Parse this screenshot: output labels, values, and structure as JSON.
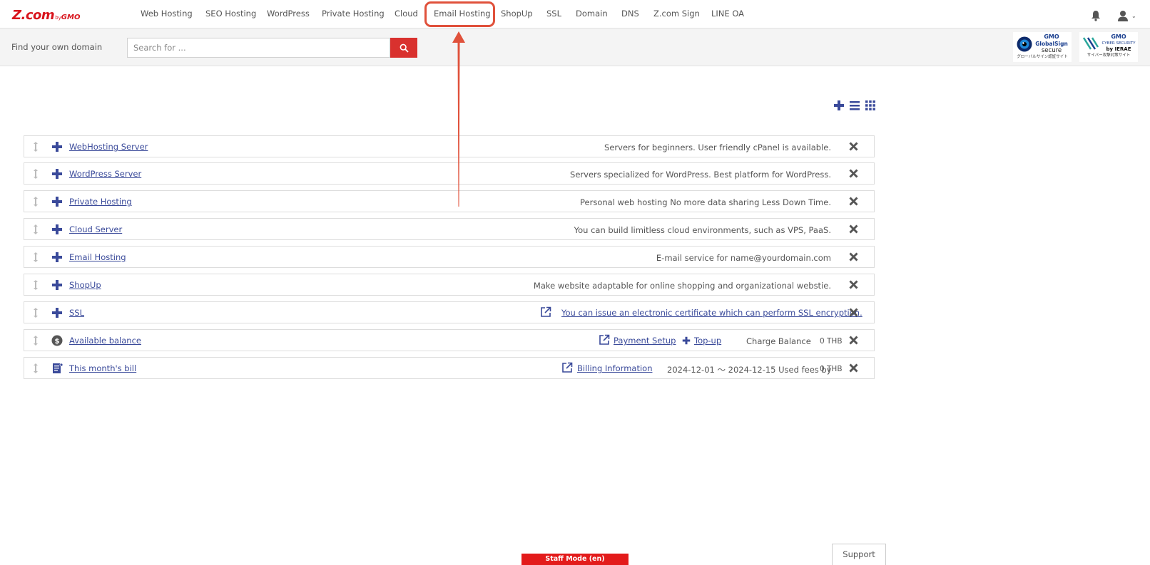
{
  "brand": {
    "logo_main": "Z.com",
    "logo_by": "by",
    "logo_gmo": "GMO"
  },
  "nav": {
    "items": [
      {
        "label": "Web Hosting"
      },
      {
        "label": "SEO Hosting"
      },
      {
        "label": "WordPress"
      },
      {
        "label": "Private Hosting"
      },
      {
        "label": "Cloud"
      },
      {
        "label": "Email Hosting"
      },
      {
        "label": "ShopUp"
      },
      {
        "label": "SSL"
      },
      {
        "label": "Domain"
      },
      {
        "label": "DNS"
      },
      {
        "label": "Z.com Sign"
      },
      {
        "label": "LINE OA"
      }
    ],
    "highlighted": "Email Hosting",
    "icons": [
      "bell-icon",
      "user-icon"
    ]
  },
  "search": {
    "label": "Find your own domain",
    "placeholder": "Search for ...",
    "value": ""
  },
  "badges": {
    "globalsign": {
      "gmo": "GMO",
      "name": "GlobalSign",
      "secure": "secure",
      "jp": "グローバルサイン認証サイト"
    },
    "ierae": {
      "gmo": "GMO",
      "name": "CYBER SECURITY",
      "by": "by IERAE",
      "jp": "サイバー攻撃対策サイト"
    }
  },
  "view_tools": [
    "plus-icon",
    "list-view-icon",
    "grid-view-icon"
  ],
  "widgets": [
    {
      "title": "WebHosting Server",
      "description": "Servers for beginners. User friendly cPanel is available.",
      "icon": "plus-icon"
    },
    {
      "title": "WordPress Server",
      "description": "Servers specialized for WordPress. Best platform for WordPress.",
      "icon": "plus-icon"
    },
    {
      "title": "Private Hosting",
      "description": "Personal web hosting No more data sharing Less Down Time.",
      "icon": "plus-icon"
    },
    {
      "title": "Cloud Server",
      "description": "You can build limitless cloud environments, such as VPS, PaaS.",
      "icon": "plus-icon"
    },
    {
      "title": "Email Hosting",
      "description": "E-mail service for name@yourdomain.com",
      "icon": "plus-icon"
    },
    {
      "title": "ShopUp",
      "description": "Make website adaptable for online shopping and organizational webstie.",
      "icon": "plus-icon"
    },
    {
      "title": "SSL",
      "link": "You can issue an electronic certificate which can perform SSL encryption.",
      "icon": "plus-icon"
    },
    {
      "title": "Available balance",
      "payment_link": "Payment Setup",
      "topup_link": "Top-up",
      "charge_label": "Charge Balance",
      "amount": "0 THB",
      "icon": "coin-icon"
    },
    {
      "title": "This month's bill",
      "billing_link": "Billing Information",
      "period": "2024-12-01 〜 2024-12-15 Used fees by",
      "amount": "0 THB",
      "icon": "bill-icon"
    }
  ],
  "footer": {
    "staff_mode": "Staff Mode (en)",
    "support": "Support"
  },
  "colors": {
    "brand_red": "#d8141c",
    "link_blue": "#3a4a9a",
    "annotation": "#e0513b"
  }
}
